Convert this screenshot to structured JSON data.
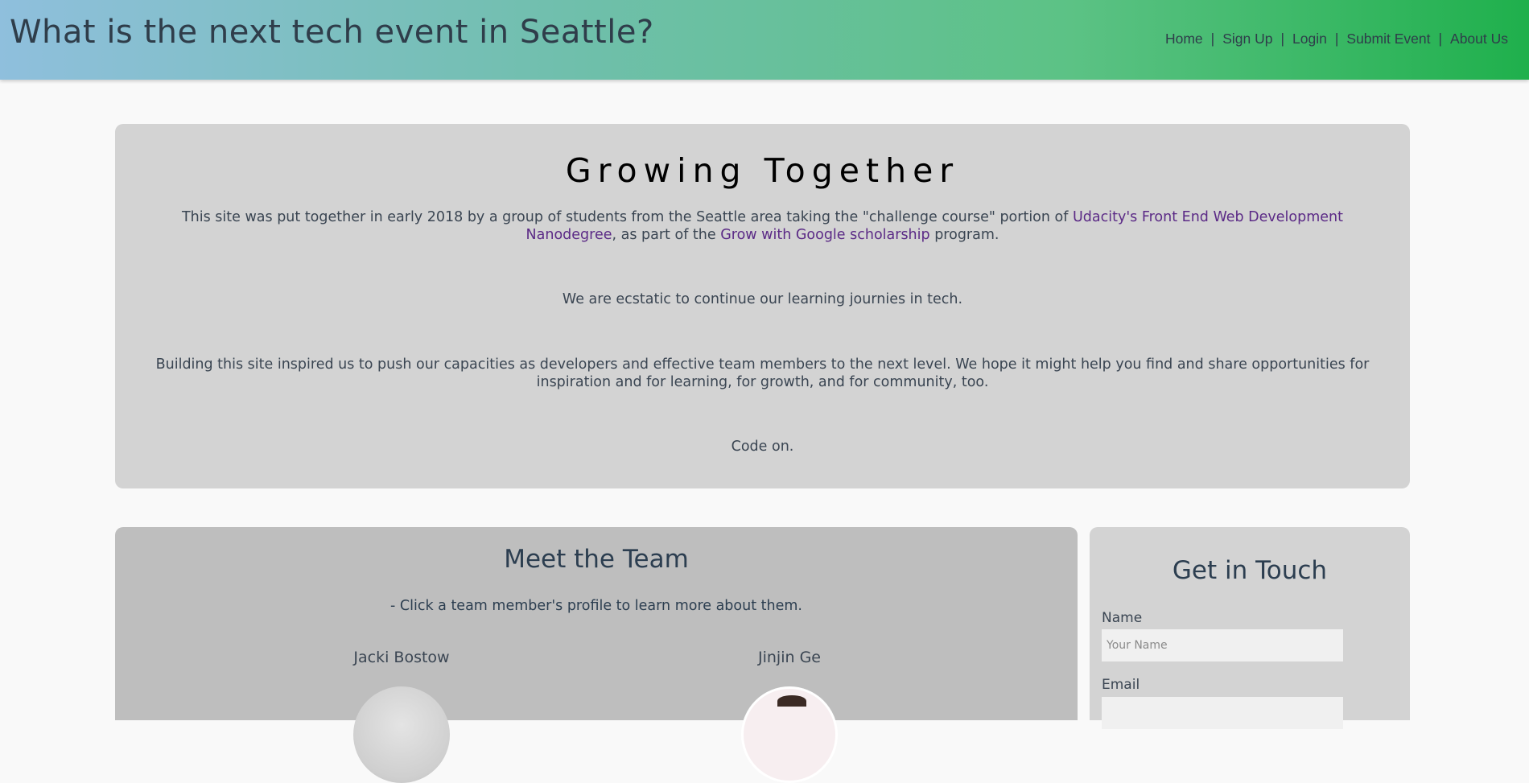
{
  "header": {
    "title": "What is the next tech event in Seattle?",
    "nav": [
      {
        "label": "Home"
      },
      {
        "label": "Sign Up"
      },
      {
        "label": "Login"
      },
      {
        "label": "Submit Event"
      },
      {
        "label": "About Us"
      }
    ],
    "separator": "|"
  },
  "about": {
    "title": "Growing Together",
    "p1_before": "This site was put together in early 2018 by a group of students from the Seattle area taking the \"challenge course\" portion of ",
    "p1_link1": "Udacity's Front End Web Development Nanodegree",
    "p1_middle": ", as part of the ",
    "p1_link2": "Grow with Google scholarship",
    "p1_after": " program.",
    "p2": "We are ecstatic to continue our learning journies in tech.",
    "p3": "Building this site inspired us to push our capacities as developers and effective team members to the next level. We hope it might help you find and share opportunities for inspiration and for learning, for growth, and for community, too.",
    "p4": "Code on."
  },
  "team": {
    "title": "Meet the Team",
    "subtitle": "- Click a team member's profile to learn more about them.",
    "members": [
      {
        "name": "Jacki Bostow"
      },
      {
        "name": "Jinjin Ge"
      }
    ]
  },
  "contact": {
    "title": "Get in Touch",
    "name_label": "Name",
    "name_placeholder": "Your Name",
    "email_label": "Email"
  },
  "colors": {
    "header_gradient_start": "#8fbfdd",
    "header_gradient_end": "#1fb04c",
    "link": "#5b2a86",
    "panel": "#d3d3d3",
    "team_panel": "#bebebe"
  }
}
